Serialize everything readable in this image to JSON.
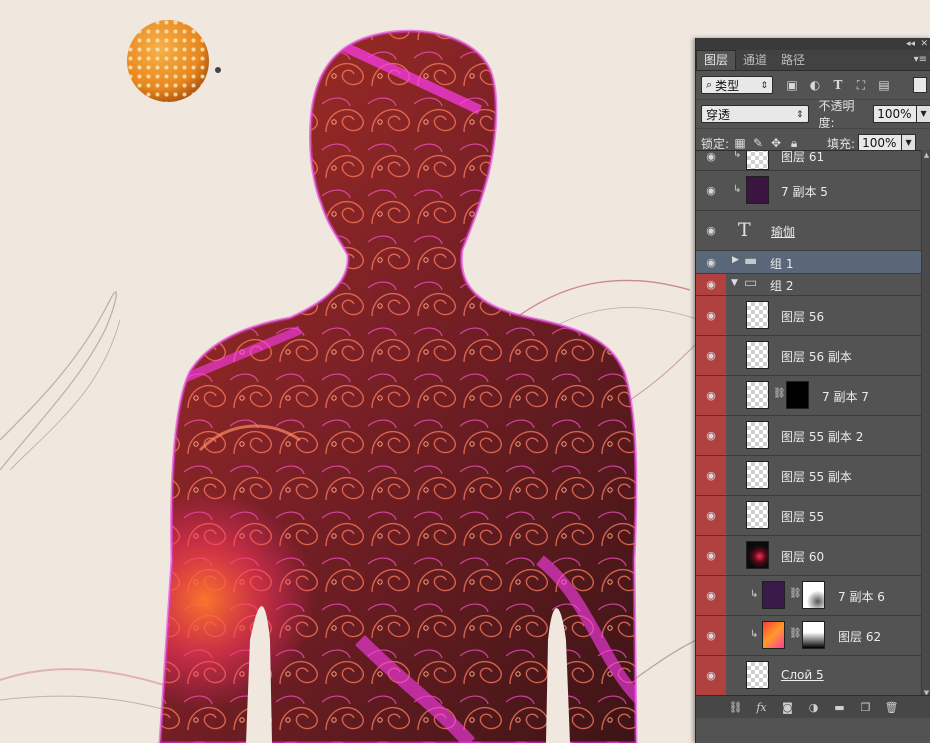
{
  "panel": {
    "tabs": [
      "图层",
      "通道",
      "路径"
    ],
    "filter_kind": "类型",
    "blend_mode": "穿透",
    "opacity_label": "不透明度:",
    "opacity_value": "100%",
    "lock_label": "锁定:",
    "fill_label": "填充:",
    "fill_value": "100%"
  },
  "layers": [
    {
      "name": "图层 61",
      "eye_red": false,
      "type": "pixel"
    },
    {
      "name": "7 副本 5",
      "eye_red": false,
      "type": "pixel-clip"
    },
    {
      "name": "瑜伽",
      "eye_red": false,
      "type": "text"
    },
    {
      "name": "组 1",
      "eye_red": false,
      "type": "group-collapsed"
    },
    {
      "name": "组 2",
      "eye_red": true,
      "type": "group-expanded"
    },
    {
      "name": "图层 56",
      "eye_red": true,
      "type": "pixel"
    },
    {
      "name": "图层 56 副本",
      "eye_red": true,
      "type": "pixel"
    },
    {
      "name": "7 副本 7",
      "eye_red": true,
      "type": "masked"
    },
    {
      "name": "图层 55 副本 2",
      "eye_red": true,
      "type": "pixel"
    },
    {
      "name": "图层 55 副本",
      "eye_red": true,
      "type": "pixel"
    },
    {
      "name": "图层 55",
      "eye_red": true,
      "type": "pixel"
    },
    {
      "name": "图层 60",
      "eye_red": true,
      "type": "pixel-dark"
    },
    {
      "name": "7 副本 6",
      "eye_red": true,
      "type": "masked-clip"
    },
    {
      "name": "图层 62",
      "eye_red": true,
      "type": "masked-clip"
    },
    {
      "name": "Слой 5",
      "eye_red": true,
      "type": "pixel"
    }
  ],
  "colors": {
    "panel_bg": "#535353",
    "selected_row": "#5a6779",
    "eye_red": "#b0413e"
  }
}
